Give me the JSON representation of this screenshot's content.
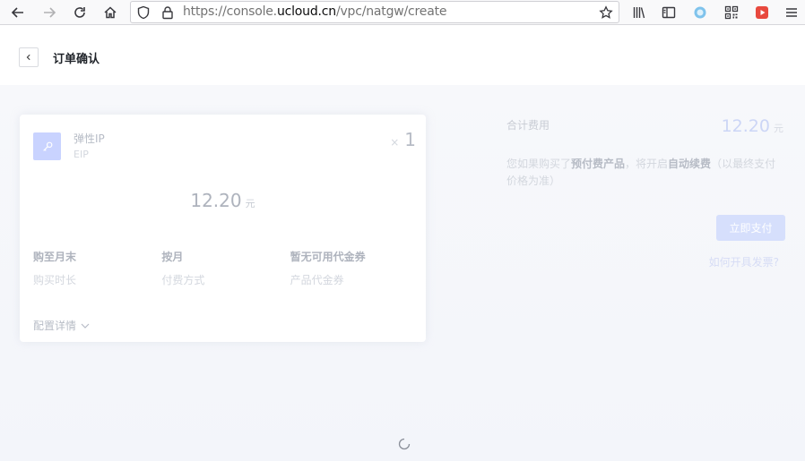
{
  "browser": {
    "url_prefix": "https://console.",
    "url_host": "ucloud.cn",
    "url_path": "/vpc/natgw/create"
  },
  "header": {
    "back_label": "<",
    "title": "订单确认"
  },
  "product": {
    "name": "弹性IP",
    "code": "EIP",
    "qty_prefix": "×",
    "quantity": "1",
    "price": "12.20",
    "price_unit": "元",
    "attributes": [
      {
        "value": "购至月末",
        "label": "购买时长"
      },
      {
        "value": "按月",
        "label": "付费方式"
      },
      {
        "value": "暂无可用代金券",
        "label": "产品代金券"
      }
    ],
    "config_details": "配置详情"
  },
  "summary": {
    "total_label": "合计费用",
    "total": "12.20",
    "total_unit": "元",
    "note_1": "您如果购买了",
    "note_2": "预付费产品",
    "note_3": "，将开启",
    "note_4": "自动续费",
    "note_5": "（以最终支付价格为准）",
    "pay_button": "立即支付",
    "invoice_link": "如何开具发票?"
  },
  "colors": {
    "accent": "#d6dffc",
    "icon_bg": "#c9d3ff"
  }
}
